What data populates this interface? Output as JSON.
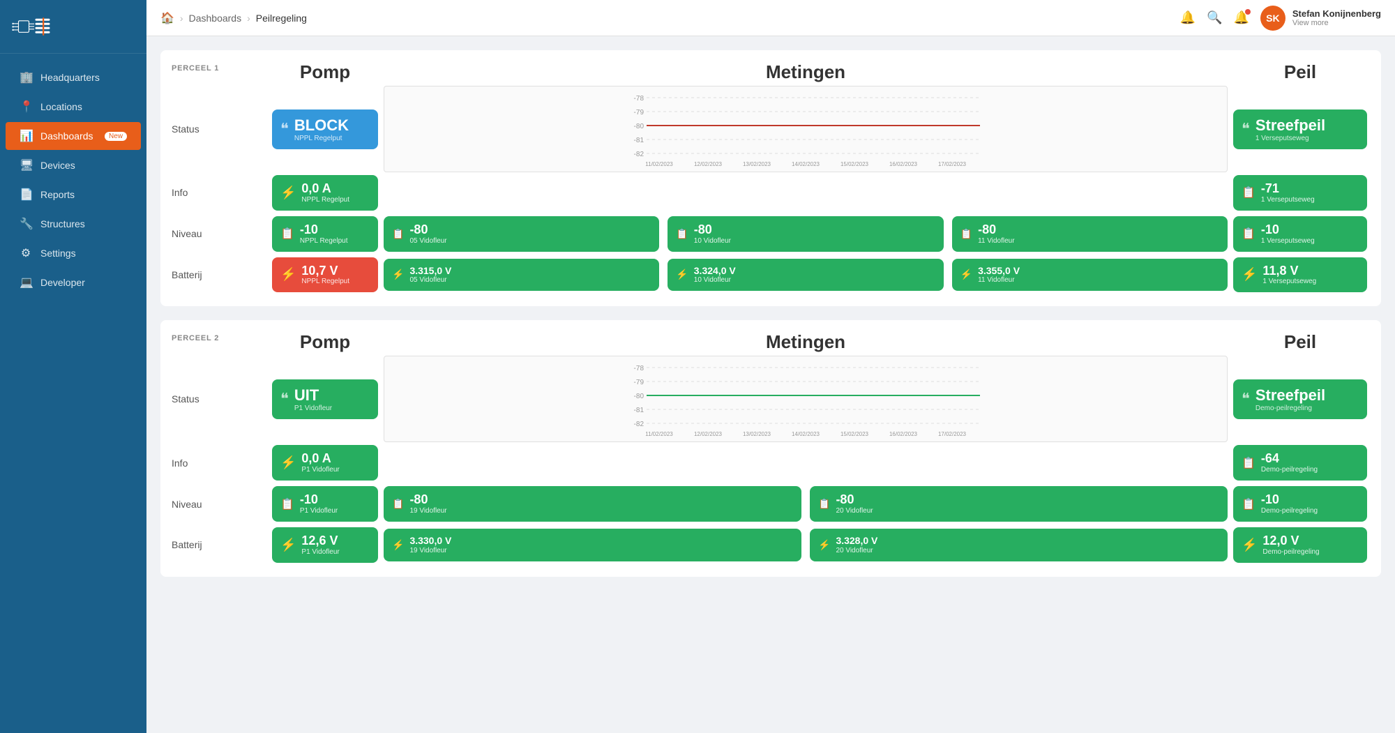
{
  "sidebar": {
    "logo_alt": "Logo",
    "nav_items": [
      {
        "id": "headquarters",
        "label": "Headquarters",
        "icon": "🏢",
        "active": false
      },
      {
        "id": "locations",
        "label": "Locations",
        "icon": "📍",
        "active": false
      },
      {
        "id": "dashboards",
        "label": "Dashboards",
        "icon": "📊",
        "active": true,
        "badge": "New"
      },
      {
        "id": "devices",
        "label": "Devices",
        "icon": "🖥",
        "active": false
      },
      {
        "id": "reports",
        "label": "Reports",
        "icon": "📄",
        "active": false
      },
      {
        "id": "structures",
        "label": "Structures",
        "icon": "🔧",
        "active": false
      },
      {
        "id": "settings",
        "label": "Settings",
        "icon": "⚙",
        "active": false
      },
      {
        "id": "developer",
        "label": "Developer",
        "icon": "💻",
        "active": false
      }
    ]
  },
  "header": {
    "breadcrumbs": [
      "Dashboards",
      "Peilregeling"
    ],
    "user_name": "Stefan Konijnenberg",
    "user_sub": "View more"
  },
  "perceel1": {
    "tag": "PERCEEL 1",
    "pomp_header": "Pomp",
    "metingen_header": "Metingen",
    "peil_header": "Peil",
    "rows": {
      "status": {
        "label": "Status",
        "pomp": {
          "type": "blue",
          "icon": "❝",
          "value": "BLOCK",
          "sub": "NPPL Regelput"
        },
        "peil": {
          "type": "green",
          "icon": "❝",
          "value": "Streefpeil",
          "sub": "1 Verseputseweg"
        }
      },
      "info": {
        "label": "Info",
        "pomp": {
          "type": "green",
          "icon": "⚡",
          "value": "0,0 A",
          "sub": "NPPL Regelput"
        },
        "peil": {
          "type": "green",
          "icon": "📄",
          "value": "-71",
          "sub": "1 Verseputseweg"
        }
      },
      "niveau": {
        "label": "Niveau",
        "pomp": {
          "type": "green",
          "icon": "📄",
          "value": "-10",
          "sub": "NPPL Regelput"
        },
        "metingen": [
          {
            "type": "green",
            "icon": "📄",
            "value": "-80",
            "sub": "05 Vidofleur"
          },
          {
            "type": "green",
            "icon": "📄",
            "value": "-80",
            "sub": "10 Vidofleur"
          },
          {
            "type": "green",
            "icon": "📄",
            "value": "-80",
            "sub": "11 Vidofleur"
          }
        ],
        "peil": {
          "type": "green",
          "icon": "📄",
          "value": "-10",
          "sub": "1 Verseputseweg"
        }
      },
      "batterij": {
        "label": "Batterij",
        "pomp": {
          "type": "red",
          "icon": "⚡",
          "value": "10,7 V",
          "sub": "NPPL Regelput"
        },
        "metingen": [
          {
            "type": "green",
            "icon": "⚡",
            "value": "3.315,0 V",
            "sub": "05 Vidofleur"
          },
          {
            "type": "green",
            "icon": "⚡",
            "value": "3.324,0 V",
            "sub": "10 Vidofleur"
          },
          {
            "type": "green",
            "icon": "⚡",
            "value": "3.355,0 V",
            "sub": "11 Vidofleur"
          }
        ],
        "peil": {
          "type": "green",
          "icon": "⚡",
          "value": "11,8 V",
          "sub": "1 Verseputseweg"
        }
      }
    },
    "chart": {
      "y_labels": [
        "-78",
        "-79",
        "-80",
        "-81",
        "-82"
      ],
      "x_labels": [
        "11/02/2023",
        "12/02/2023",
        "13/02/2023",
        "14/02/2023",
        "15/02/2023",
        "16/02/2023",
        "17/02/2023"
      ],
      "line_color": "#c0392b",
      "line_value": -80
    }
  },
  "perceel2": {
    "tag": "PERCEEL 2",
    "pomp_header": "Pomp",
    "metingen_header": "Metingen",
    "peil_header": "Peil",
    "rows": {
      "status": {
        "label": "Status",
        "pomp": {
          "type": "green",
          "icon": "❝",
          "value": "UIT",
          "sub": "P1 Vidofleur"
        },
        "peil": {
          "type": "green",
          "icon": "❝",
          "value": "Streefpeil",
          "sub": "Demo-peilregeling"
        }
      },
      "info": {
        "label": "Info",
        "pomp": {
          "type": "green",
          "icon": "⚡",
          "value": "0,0 A",
          "sub": "P1 Vidofleur"
        },
        "peil": {
          "type": "green",
          "icon": "📄",
          "value": "-64",
          "sub": "Demo-peilregeling"
        }
      },
      "niveau": {
        "label": "Niveau",
        "pomp": {
          "type": "green",
          "icon": "📄",
          "value": "-10",
          "sub": "P1 Vidofleur"
        },
        "metingen": [
          {
            "type": "green",
            "icon": "📄",
            "value": "-80",
            "sub": "19 Vidofleur"
          },
          {
            "type": "green",
            "icon": "📄",
            "value": "-80",
            "sub": "20 Vidofleur"
          }
        ],
        "peil": {
          "type": "green",
          "icon": "📄",
          "value": "-10",
          "sub": "Demo-peilregeling"
        }
      },
      "batterij": {
        "label": "Batterij",
        "pomp": {
          "type": "green",
          "icon": "⚡",
          "value": "12,6 V",
          "sub": "P1 Vidofleur"
        },
        "metingen": [
          {
            "type": "green",
            "icon": "⚡",
            "value": "3.330,0 V",
            "sub": "19 Vidofleur"
          },
          {
            "type": "green",
            "icon": "⚡",
            "value": "3.328,0 V",
            "sub": "20 Vidofleur"
          }
        ],
        "peil": {
          "type": "green",
          "icon": "⚡",
          "value": "12,0 V",
          "sub": "Demo-peilregeling"
        }
      }
    },
    "chart": {
      "y_labels": [
        "-78",
        "-79",
        "-80",
        "-81",
        "-82"
      ],
      "x_labels": [
        "11/02/2023",
        "12/02/2023",
        "13/02/2023",
        "14/02/2023",
        "15/02/2023",
        "16/02/2023",
        "17/02/2023"
      ],
      "line_color": "#27ae60",
      "line_value": -80
    }
  }
}
